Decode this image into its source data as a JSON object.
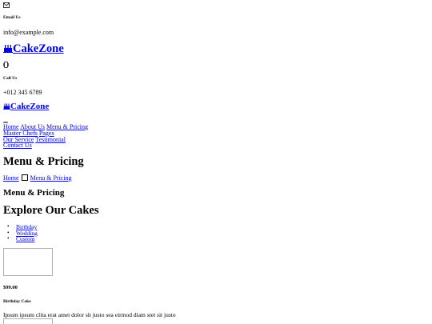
{
  "topbar": {
    "email_icon": "envelope-icon",
    "email_label": "Email Us",
    "email_value": "info@example.com",
    "phone_icon": "phone-icon",
    "call_label": "Call Us",
    "call_value": "+012 345 6789"
  },
  "brand": {
    "icon": "birthday-cake-icon",
    "name": "CakeZone"
  },
  "navbar": {
    "toggler_icon": "menu-toggler",
    "items": [
      "Home",
      "About Us",
      "Menu & Pricing",
      "Master Chefs"
    ],
    "dropdown_label": "Pages",
    "dropdown_items": [
      "Our Service",
      "Testimonial"
    ],
    "contact_label": "Contact Us"
  },
  "hero": {
    "title": "Menu & Pricing",
    "breadcrumb": {
      "home": "Home",
      "separator_icon": "square-separator-icon",
      "current": "Menu & Pricing"
    }
  },
  "menu": {
    "subtitle": "Menu & Pricing",
    "title": "Explore Our Cakes",
    "tabs": [
      "Birthday",
      "Wedding",
      "Custom"
    ],
    "item": {
      "price": "$99.00",
      "name": "Birthday Cake",
      "description": "Ipsum ipsum clita erat amet dolor sit justo sea eirmod diam stet sit justo"
    }
  },
  "colors": {
    "link": "#0000ee",
    "text": "#000000",
    "background": "#ffffff"
  }
}
